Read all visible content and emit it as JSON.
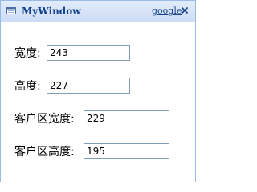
{
  "window": {
    "title": "MyWindow",
    "link_label": "google",
    "title_icon": "window-icon",
    "close_icon": "close-icon"
  },
  "fields": [
    {
      "label": "宽度:",
      "value": "243"
    },
    {
      "label": "高度:",
      "value": "227"
    },
    {
      "label": "客户区宽度:",
      "value": "229"
    },
    {
      "label": "客户区高度:",
      "value": "195"
    }
  ],
  "colors": {
    "title_text": "#15428b",
    "border": "#99bbe8",
    "input_border": "#7f9db9"
  }
}
